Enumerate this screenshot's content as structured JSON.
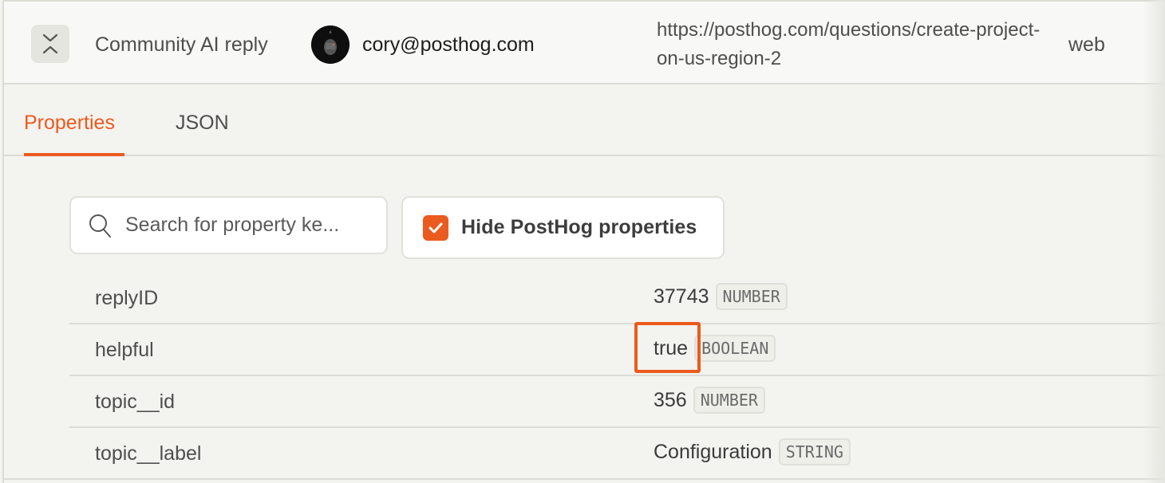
{
  "event_row": {
    "event_name": "Community AI reply",
    "person_email": "cory@posthog.com",
    "url": "https://posthog.com/questions/create-project-on-us-region-2",
    "library": "web"
  },
  "tabs": [
    {
      "label": "Properties",
      "active": true
    },
    {
      "label": "JSON",
      "active": false
    }
  ],
  "search": {
    "placeholder": "Search for property ke...",
    "value": ""
  },
  "hide_posthog": {
    "label": "Hide PostHog properties",
    "checked": true
  },
  "properties": [
    {
      "key": "replyID",
      "value": "37743",
      "type": "NUMBER"
    },
    {
      "key": "helpful",
      "value": "true",
      "type": "BOOLEAN"
    },
    {
      "key": "topic__id",
      "value": "356",
      "type": "NUMBER"
    },
    {
      "key": "topic__label",
      "value": "Configuration",
      "type": "STRING"
    }
  ],
  "highlight": {
    "target": "helpful value",
    "color": "#eb5a1e"
  },
  "colors": {
    "accent": "#eb5a1e",
    "background": "#f3f3ef",
    "border": "#dcdcd6"
  }
}
